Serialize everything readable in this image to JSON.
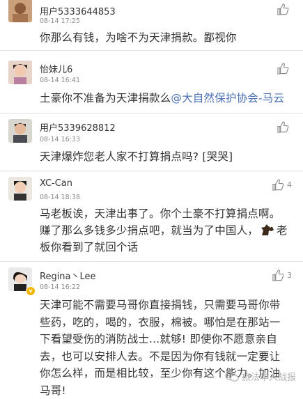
{
  "comments": [
    {
      "user": "用户5333644853",
      "time": "08-14 17:25",
      "text": "你那么有钱，为啥不为天津捐款。鄙视你",
      "likes": ""
    },
    {
      "user": "怡妹儿6",
      "time": "08-14 16:41",
      "text": "土豪你不准备为天津捐款么",
      "mention": "@大自然保护协会-马云",
      "likes": ""
    },
    {
      "user": "用户5339628812",
      "time": "08-14 16:33",
      "text": "天津爆炸您老人家不打算捐点吗? [哭哭]",
      "likes": ""
    },
    {
      "user": "XC-Can",
      "time": "08-14 18:38",
      "text_line1": "马老板诶，天津出事了。你个土豪不打算捐点啊。",
      "text_line2a": "赚了那么多钱多少捐点吧，就当为了中国人，",
      "text_line2b": "老",
      "text_line3": "板你看到了就回个话",
      "likes": "4"
    },
    {
      "user": "Regina丶Lee",
      "time": "08-14 16:22",
      "lines": [
        "天津可能不需要马哥你直接捐钱，只需要马哥你带",
        "些药，吃的，喝的，衣服，棉被。哪怕是在那站一",
        "下看望受伤的消防战士...就够! 即使你不愿意亲自",
        "去，也可以安排人去。不是因为你有钱就一定要让",
        "你怎么样，而是相比较，至少你有这个能力。加油",
        "马哥!"
      ],
      "likes": "3"
    }
  ],
  "watermark": "旅法华人战报",
  "colors": {
    "mention": "#4a6fb5",
    "time": "#8a8a8a",
    "divider": "#e2e2e2"
  }
}
